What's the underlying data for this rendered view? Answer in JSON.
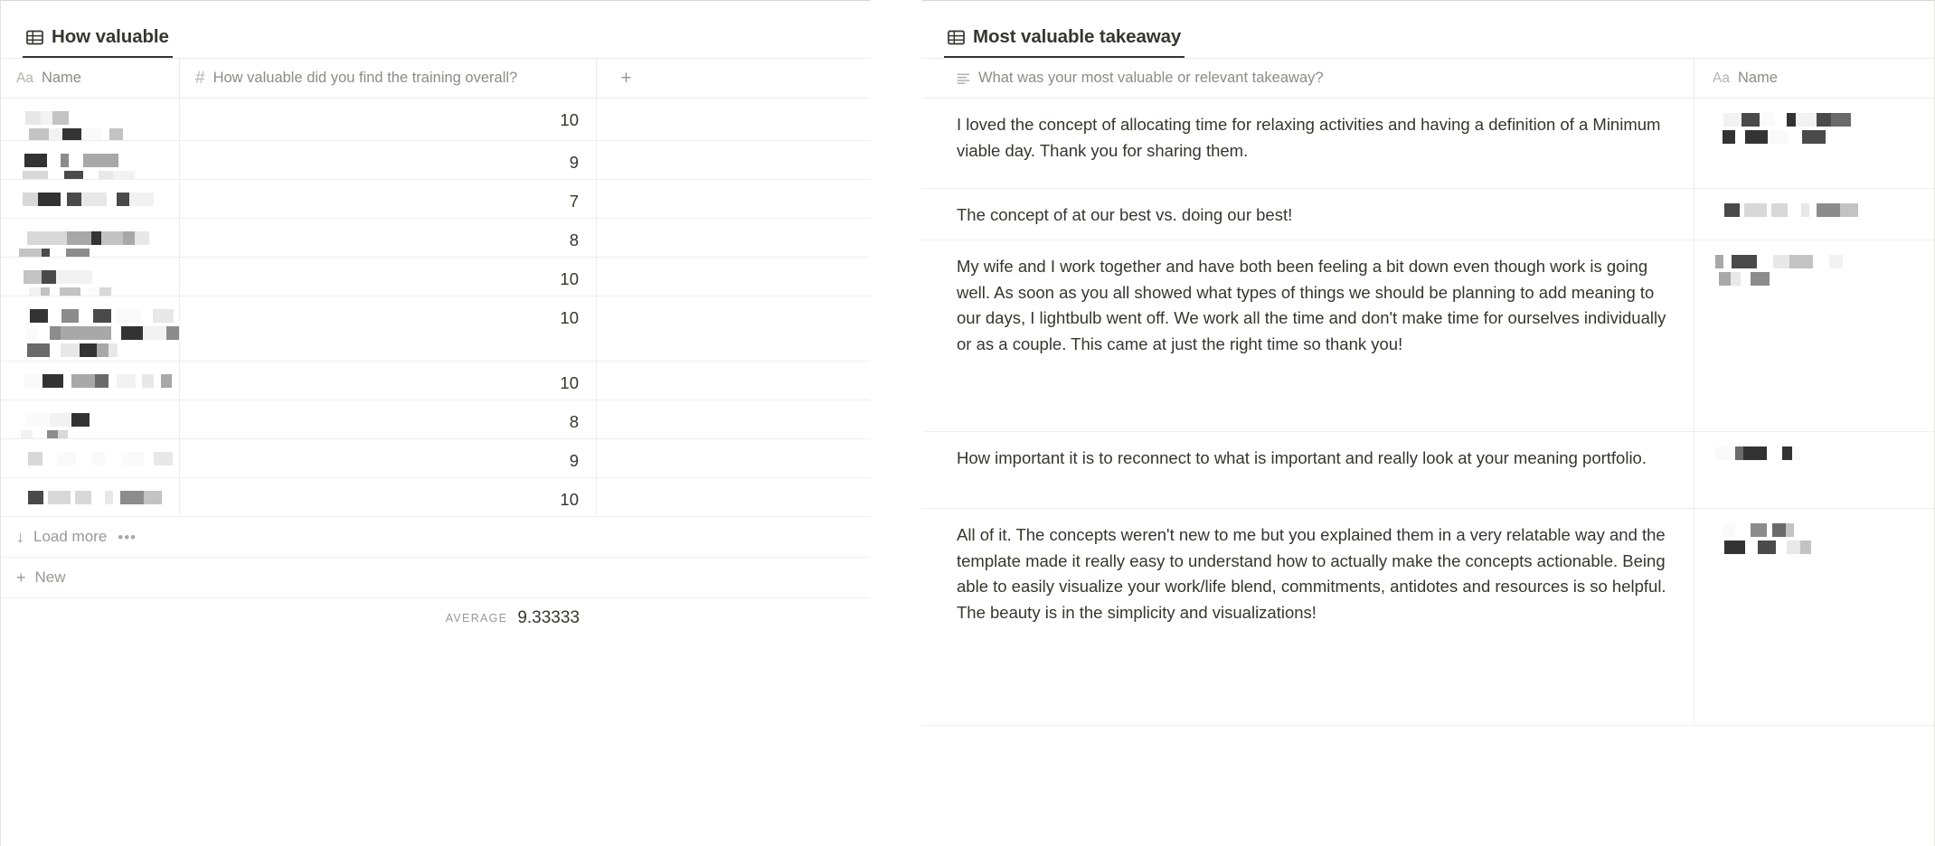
{
  "left_panel": {
    "view_tab": {
      "label": "How valuable",
      "icon": "table-grid-icon"
    },
    "columns": [
      {
        "type_icon": "text-type-icon",
        "type_glyph": "Aa",
        "label": "Name"
      },
      {
        "type_icon": "number-type-icon",
        "type_glyph": "#",
        "label": "How valuable did you find the training overall?"
      }
    ],
    "add_column_label": "+",
    "rows": [
      {
        "name": "",
        "name_redacted": true,
        "rating": "10"
      },
      {
        "name": "",
        "name_redacted": true,
        "rating": "9"
      },
      {
        "name": "",
        "name_redacted": true,
        "rating": "7"
      },
      {
        "name": "",
        "name_redacted": true,
        "rating": "8"
      },
      {
        "name": "",
        "name_redacted": true,
        "rating": "10"
      },
      {
        "name": "",
        "name_redacted": true,
        "rating": "10"
      },
      {
        "name": "",
        "name_redacted": true,
        "rating": "10"
      },
      {
        "name": "",
        "name_redacted": true,
        "rating": "8"
      },
      {
        "name": "",
        "name_redacted": true,
        "rating": "9"
      },
      {
        "name": "",
        "name_redacted": true,
        "rating": "10"
      }
    ],
    "load_more": {
      "label": "Load more",
      "arrow": "↓",
      "more_options": "•••"
    },
    "new_row": {
      "label": "New",
      "plus": "+"
    },
    "aggregate": {
      "label": "AVERAGE",
      "value": "9.33333"
    }
  },
  "right_panel": {
    "view_tab": {
      "label": "Most valuable takeaway",
      "icon": "table-grid-icon"
    },
    "columns": [
      {
        "type_icon": "long-text-type-icon",
        "type_glyph": "≡",
        "label": "What was your most valuable or relevant takeaway?"
      },
      {
        "type_icon": "text-type-icon",
        "type_glyph": "Aa",
        "label": "Name"
      }
    ],
    "rows": [
      {
        "takeaway": "I loved the concept of allocating time for relaxing activities and having a definition of a  Minimum viable day. Thank you for sharing them.",
        "name": "",
        "name_redacted": true
      },
      {
        "takeaway": "The concept of at our best vs. doing our best!",
        "name": "",
        "name_redacted": true
      },
      {
        "takeaway": "My wife and I work together and have both been feeling a bit down even though work is going well. As soon as you all showed what types of things we should be planning to add meaning to our days, I lightbulb went off. We work all the time and don't make time for ourselves individually or as a couple. This came at just the right time so thank you!",
        "name": "",
        "name_redacted": true
      },
      {
        "takeaway": "How important it is to reconnect to what is important and really look at your meaning portfolio.",
        "name": "",
        "name_redacted": true
      },
      {
        "takeaway": "All of it. The concepts weren't new to me but you explained them in a very relatable way and the template made it really easy to understand how to actually make the concepts actionable. Being able to easily visualize your work/life blend, commitments, antidotes and resources is so helpful. The beauty is in the simplicity and visualizations!",
        "name": "",
        "name_redacted": true
      }
    ]
  },
  "colors": {
    "text": "#37352f",
    "muted": "#8d8b87",
    "border": "#efeeed",
    "accent": "#37352f",
    "background": "#ffffff"
  }
}
